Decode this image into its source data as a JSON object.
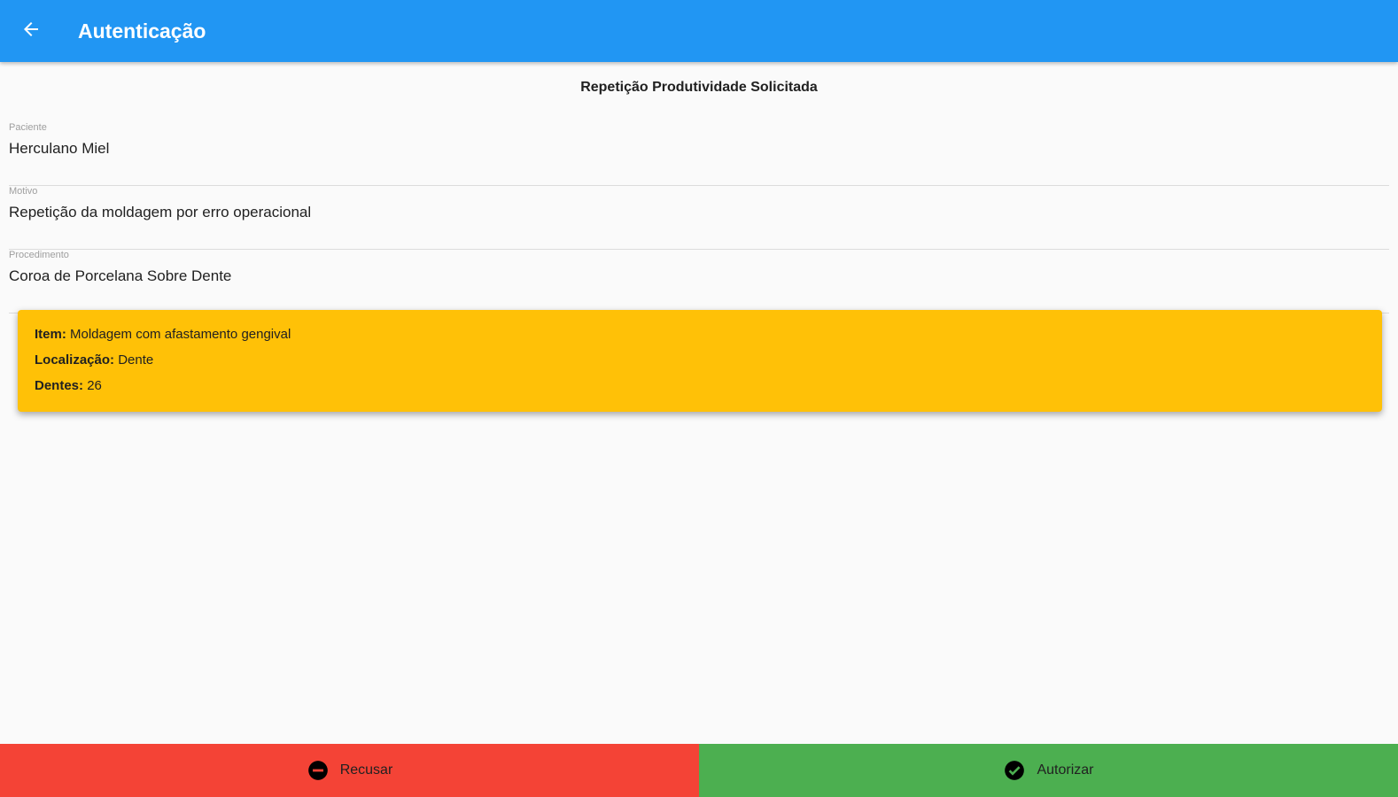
{
  "appbar": {
    "title": "Autenticação",
    "back_icon": "arrow-back-icon",
    "color": "#2196f3"
  },
  "main": {
    "section_title": "Repetição Produtividade Solicitada",
    "fields": [
      {
        "label": "Paciente",
        "value": "Herculano Miel"
      },
      {
        "label": "Motivo",
        "value": "Repetição da moldagem por erro operacional"
      },
      {
        "label": "Procedimento",
        "value": "Coroa de Porcelana Sobre Dente"
      }
    ],
    "card": {
      "color": "#ffc107",
      "item_label": "Item:",
      "item_value": "Moldagem com afastamento gengival",
      "location_label": "Localização:",
      "location_value": "Dente",
      "teeth_label": "Dentes:",
      "teeth_value": "26"
    }
  },
  "actions": {
    "refuse_label": "Recusar",
    "refuse_icon": "minus-circle-icon",
    "refuse_color": "#f44336",
    "authorize_label": "Autorizar",
    "authorize_icon": "check-circle-icon",
    "authorize_color": "#4caf50"
  }
}
